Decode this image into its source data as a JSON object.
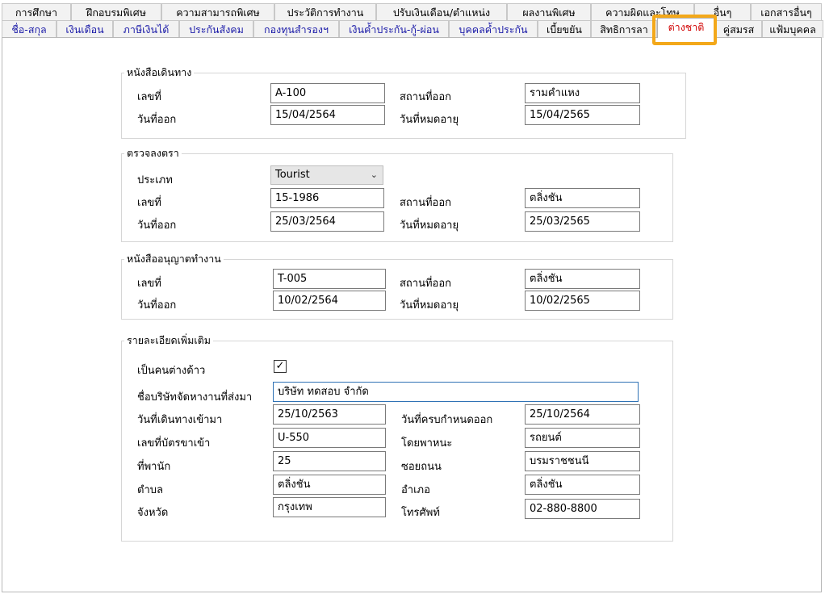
{
  "tabs_row1": [
    {
      "label": "การศึกษา"
    },
    {
      "label": "ฝึกอบรมพิเศษ"
    },
    {
      "label": "ความสามารถพิเศษ"
    },
    {
      "label": "ประวัติการทำงาน"
    },
    {
      "label": "ปรับเงินเดือน/ตำแหน่ง"
    },
    {
      "label": "ผลงานพิเศษ"
    },
    {
      "label": "ความผิดและโทษ"
    },
    {
      "label": "อื่นๆ"
    },
    {
      "label": "เอกสารอื่นๆ"
    }
  ],
  "tabs_row2": [
    {
      "label": "ชื่อ-สกุล"
    },
    {
      "label": "เงินเดือน"
    },
    {
      "label": "ภาษีเงินได้"
    },
    {
      "label": "ประกันสังคม"
    },
    {
      "label": "กองทุนสำรองฯ"
    },
    {
      "label": "เงินค้ำประกัน-กู้-ผ่อน"
    },
    {
      "label": "บุคคลค้ำประกัน"
    },
    {
      "label": "เบี้ยขยัน"
    },
    {
      "label": "สิทธิการลา"
    },
    {
      "label": "ต่างชาติ"
    },
    {
      "label": "คู่สมรส"
    },
    {
      "label": "แฟ้มบุคคล"
    }
  ],
  "passport": {
    "legend": "หนังสือเดินทาง",
    "number_label": "เลขที่",
    "number": "A-100",
    "place_label": "สถานที่ออก",
    "place": "รามคำแหง",
    "issue_label": "วันที่ออก",
    "issue": "15/04/2564",
    "expire_label": "วันที่หมดอายุ",
    "expire": "15/04/2565"
  },
  "visa": {
    "legend": "ตรวจลงตรา",
    "type_label": "ประเภท",
    "type": "Tourist",
    "number_label": "เลขที่",
    "number": "15-1986",
    "place_label": "สถานที่ออก",
    "place": "ตลิ่งชัน",
    "issue_label": "วันที่ออก",
    "issue": "25/03/2564",
    "expire_label": "วันที่หมดอายุ",
    "expire": "25/03/2565"
  },
  "work_permit": {
    "legend": "หนังสืออนุญาตทำงาน",
    "number_label": "เลขที่",
    "number": "T-005",
    "place_label": "สถานที่ออก",
    "place": "ตลิ่งชัน",
    "issue_label": "วันที่ออก",
    "issue": "10/02/2564",
    "expire_label": "วันที่หมดอายุ",
    "expire": "10/02/2565"
  },
  "details": {
    "legend": "รายละเอียดเพิ่มเติม",
    "alien_label": "เป็นคนต่างด้าว",
    "alien_checked": "✓",
    "company_label": "ชื่อบริษัทจัดหางานที่ส่งมา",
    "company": "บริษัท ทดสอบ จำกัด",
    "entry_date_label": "วันที่เดินทางเข้ามา",
    "entry_date": "25/10/2563",
    "due_date_label": "วันที่ครบกำหนดออก",
    "due_date": "25/10/2564",
    "entry_card_label": "เลขที่บัตรขาเข้า",
    "entry_card": "U-550",
    "vehicle_label": "โดยพาหนะ",
    "vehicle": "รถยนต์",
    "residence_label": "ที่พานัก",
    "residence": "25",
    "street_label": "ซอยถนน",
    "street": "บรมราชชนนี",
    "subdistrict_label": "ตำบล",
    "subdistrict": "ตลิ่งชัน",
    "district_label": "อำเภอ",
    "district": "ตลิ่งชัน",
    "province_label": "จังหวัด",
    "province": "กรุงเทพ",
    "phone_label": "โทรศัพท์",
    "phone": "02-880-8800"
  }
}
